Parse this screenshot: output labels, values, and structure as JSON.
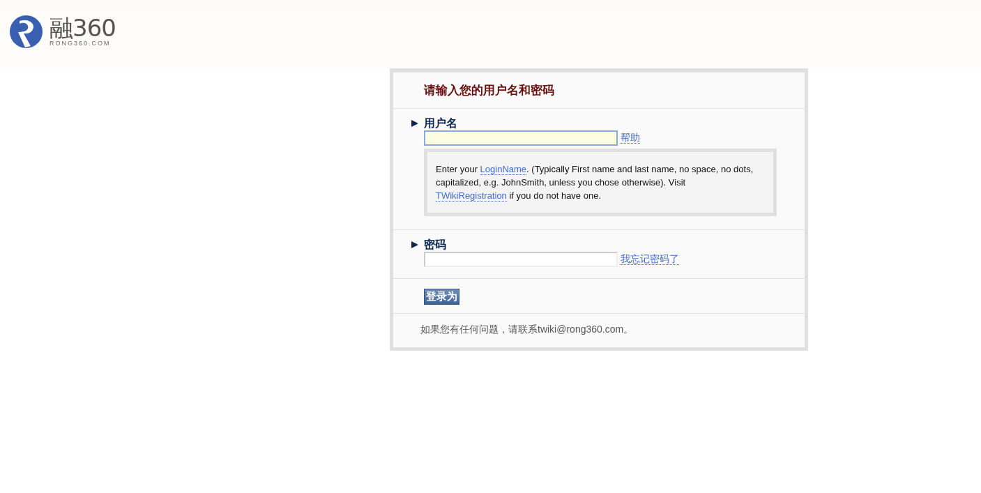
{
  "logo": {
    "name": "融360",
    "domain": "RONG360.COM"
  },
  "login": {
    "title": "请输入您的用户名和密码",
    "fields": [
      {
        "label": "用户名",
        "focused": true,
        "link": "帮助",
        "help": [
          {
            "kind": "text",
            "text": "Enter your "
          },
          {
            "kind": "link",
            "text": "LoginName"
          },
          {
            "kind": "text",
            "text": ". (Typically First name and last name, no space, no dots, capitalized, e.g. JohnSmith, unless you chose otherwise). Visit "
          },
          {
            "kind": "link",
            "text": "TWikiRegistration"
          },
          {
            "kind": "text",
            "text": " if you do not have one."
          }
        ]
      },
      {
        "label": "密码",
        "focused": false,
        "link": "我忘记密码了"
      }
    ],
    "submit": "登录为",
    "contact": "如果您有任何问题，请联系twiki@rong360.com。"
  }
}
